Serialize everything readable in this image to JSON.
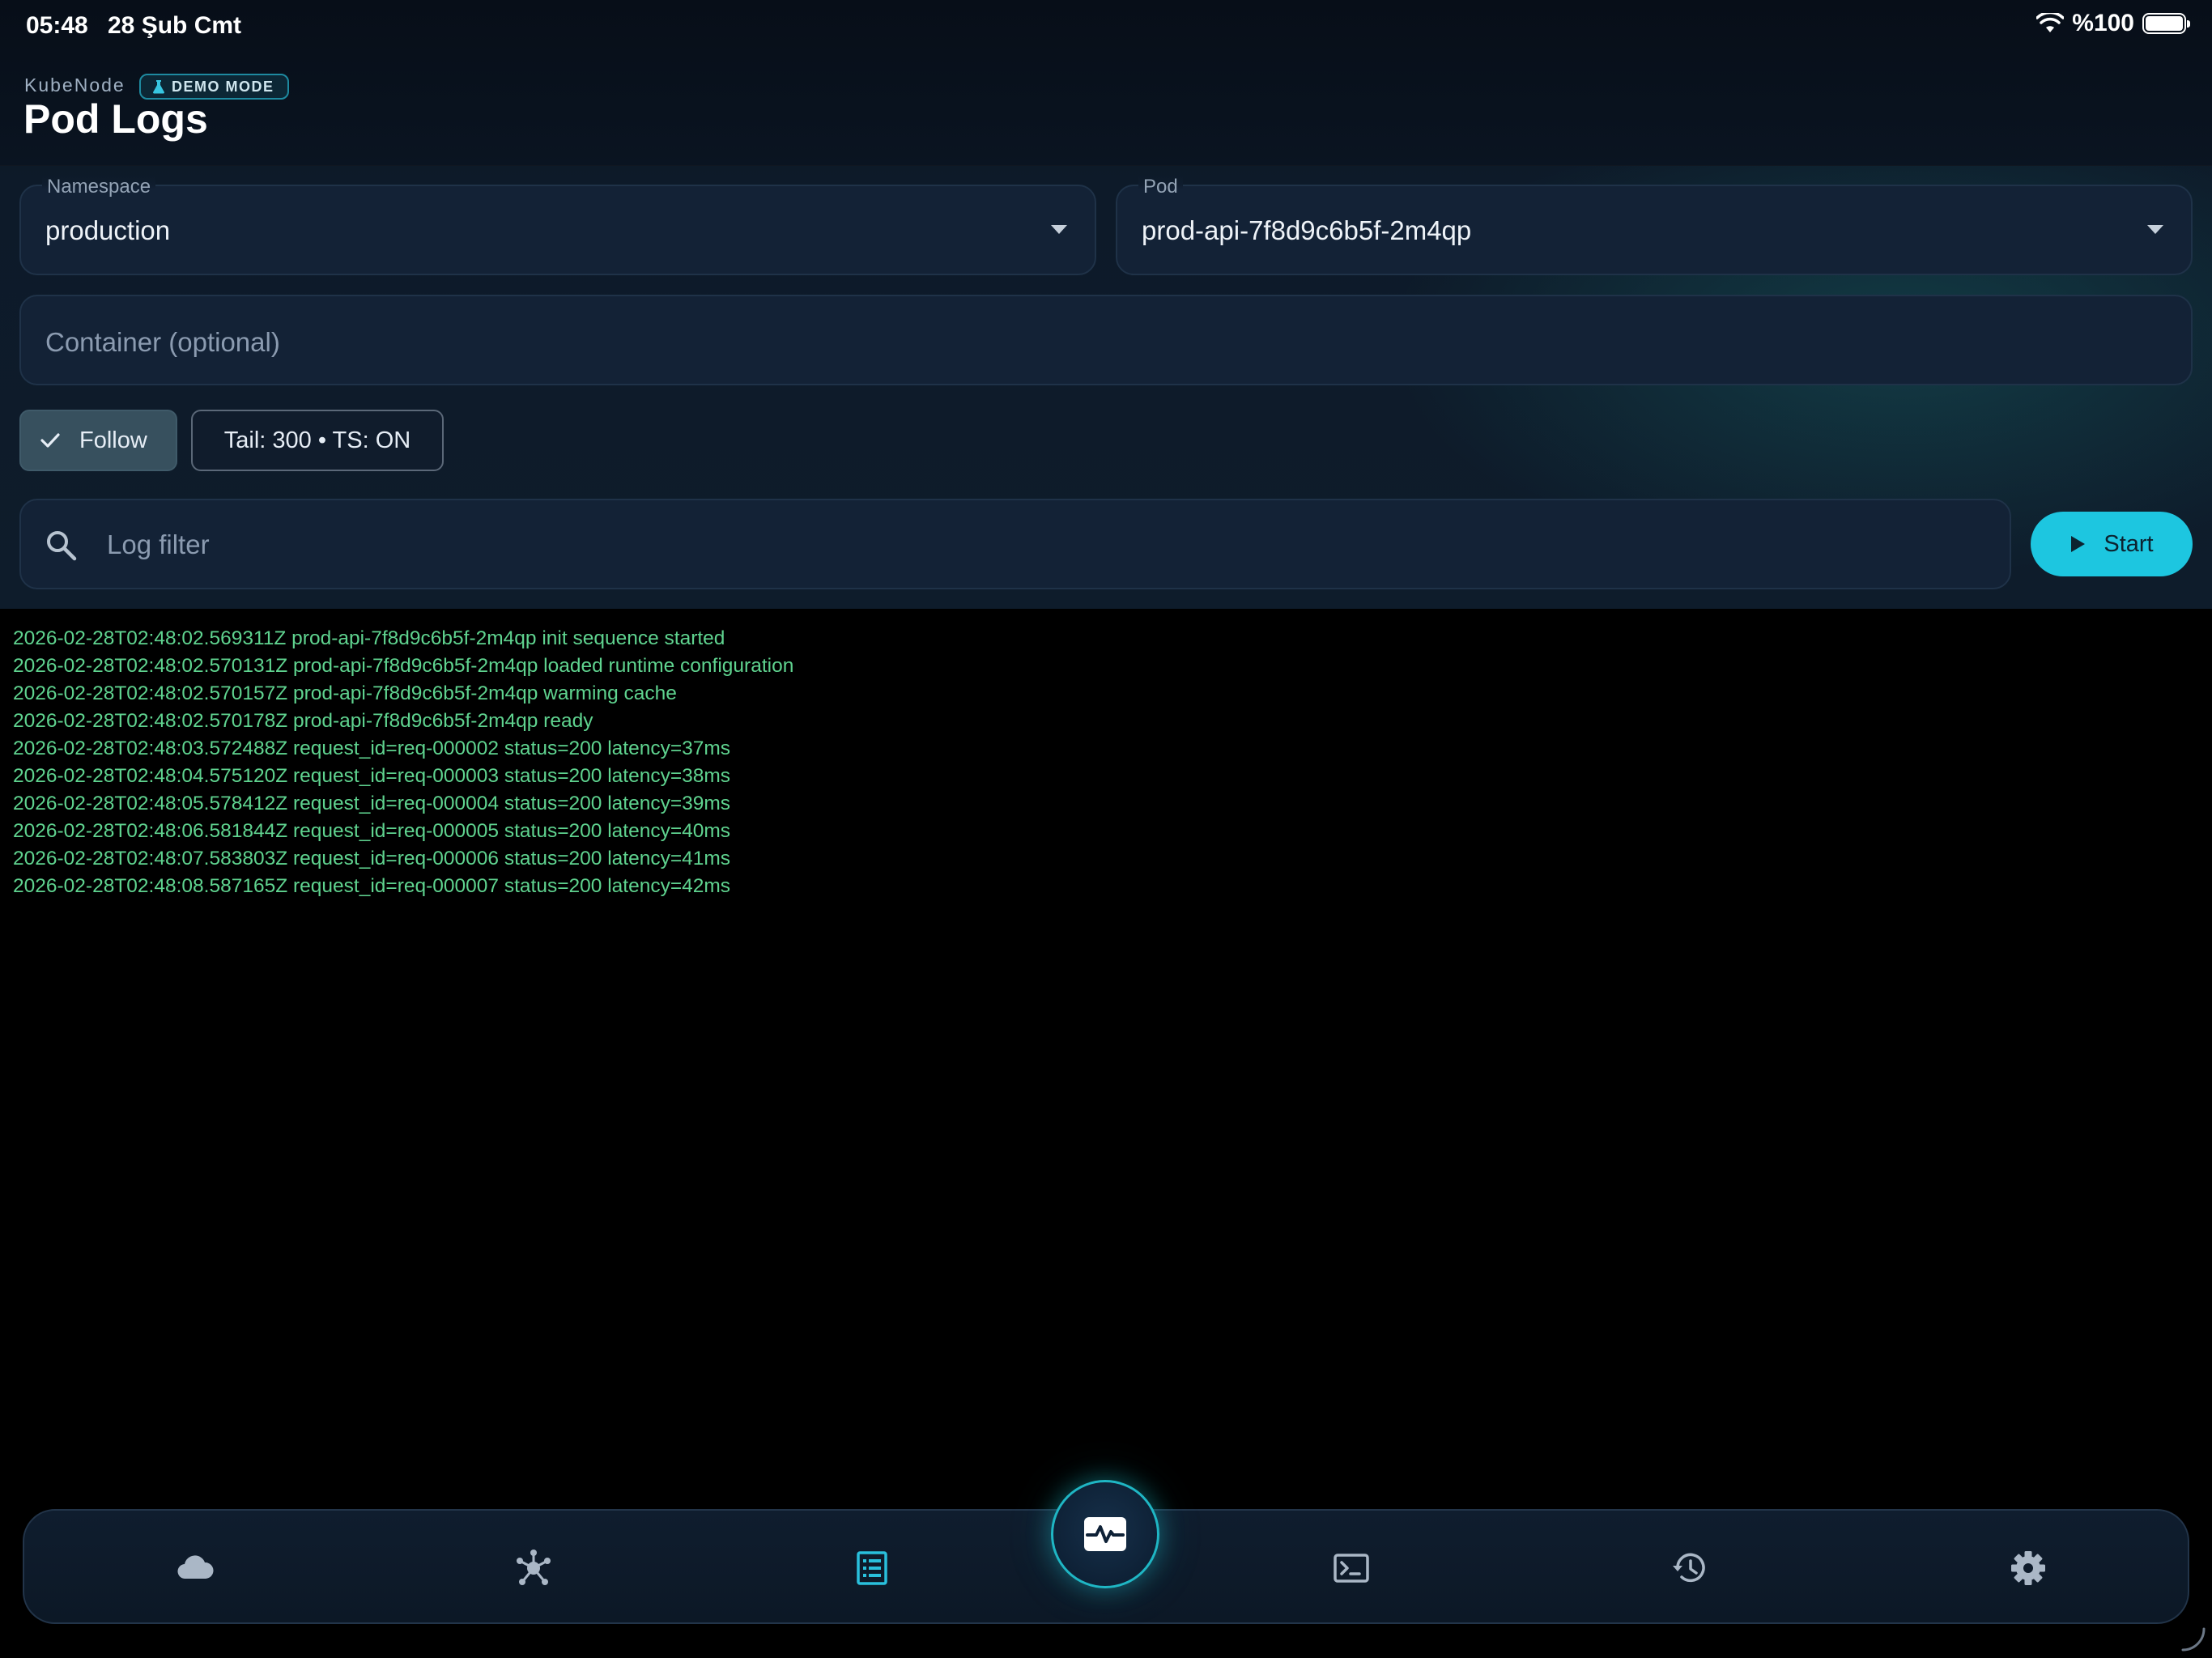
{
  "status_bar": {
    "time": "05:48",
    "date": "28 Şub Cmt",
    "battery": "%100"
  },
  "header": {
    "app_name": "KubeNode",
    "badge": "DEMO MODE",
    "title": "Pod Logs"
  },
  "form": {
    "namespace": {
      "label": "Namespace",
      "value": "production"
    },
    "pod": {
      "label": "Pod",
      "value": "prod-api-7f8d9c6b5f-2m4qp"
    },
    "container": {
      "placeholder": "Container (optional)"
    }
  },
  "chips": {
    "follow": {
      "label": "Follow",
      "selected": true
    },
    "tail": {
      "label": "Tail: 300 • TS: ON"
    }
  },
  "filter": {
    "placeholder": "Log filter"
  },
  "start_button": {
    "label": "Start"
  },
  "logs": [
    "2026-02-28T02:48:02.569311Z prod-api-7f8d9c6b5f-2m4qp init sequence started",
    "2026-02-28T02:48:02.570131Z prod-api-7f8d9c6b5f-2m4qp loaded runtime configuration",
    "2026-02-28T02:48:02.570157Z prod-api-7f8d9c6b5f-2m4qp warming cache",
    "2026-02-28T02:48:02.570178Z prod-api-7f8d9c6b5f-2m4qp ready",
    "2026-02-28T02:48:03.572488Z request_id=req-000002 status=200 latency=37ms",
    "2026-02-28T02:48:04.575120Z request_id=req-000003 status=200 latency=38ms",
    "2026-02-28T02:48:05.578412Z request_id=req-000004 status=200 latency=39ms",
    "2026-02-28T02:48:06.581844Z request_id=req-000005 status=200 latency=40ms",
    "2026-02-28T02:48:07.583803Z request_id=req-000006 status=200 latency=41ms",
    "2026-02-28T02:48:08.587165Z request_id=req-000007 status=200 latency=42ms"
  ],
  "nav": {
    "items": [
      {
        "icon": "cloud-icon",
        "active": false
      },
      {
        "icon": "cluster-icon",
        "active": false
      },
      {
        "icon": "logs-list-icon",
        "active": true
      },
      {
        "icon": "terminal-icon",
        "active": false
      },
      {
        "icon": "history-icon",
        "active": false
      },
      {
        "icon": "gear-icon",
        "active": false
      }
    ],
    "center_icon": "pulse-monitor-icon"
  },
  "colors": {
    "accent": "#1dc6e0",
    "log_text": "#5fd38f",
    "background": "#000000",
    "surface": "#132236",
    "nav_icon": "#aab7c6"
  }
}
